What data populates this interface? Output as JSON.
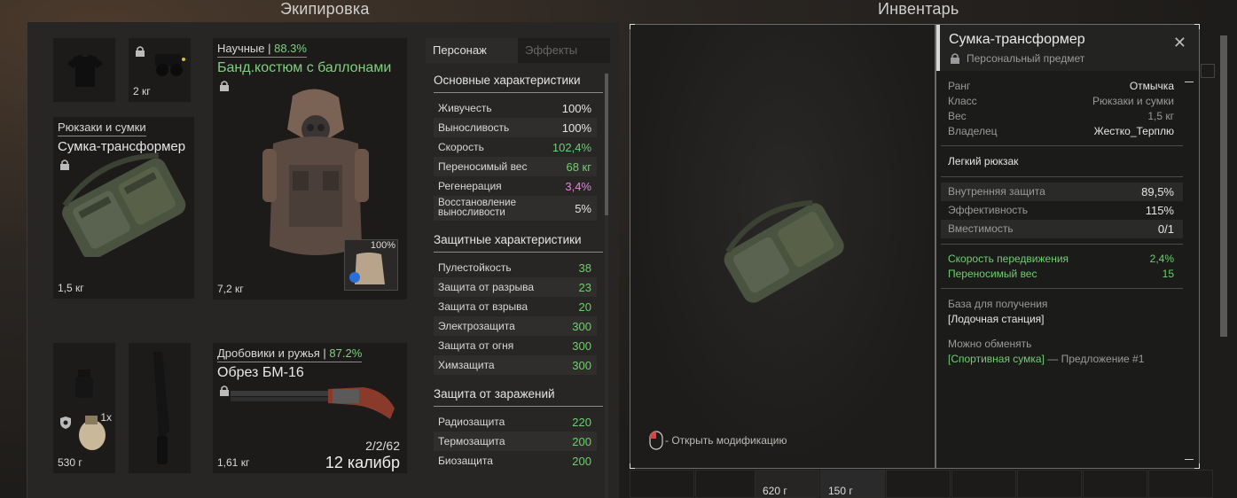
{
  "equipment": {
    "title": "Экипировка",
    "helmet_slot_weight": "",
    "nvg_slot_weight": "2 кг",
    "backpack": {
      "category": "Рюкзаки и сумки",
      "name": "Сумка-трансформер",
      "weight": "1,5 кг"
    },
    "armor": {
      "category": "Научные",
      "percent": "88.3%",
      "name": "Банд.костюм с баллонами",
      "weight": "7,2 кг",
      "plate_percent": "100%"
    },
    "secondary_slot": {
      "count": "1x",
      "weight": "530 г"
    },
    "weapon": {
      "category": "Дробовики и ружья",
      "percent": "87.2%",
      "name": "Обрез БМ-16",
      "weight": "1,61 кг",
      "ammo": "2/2/62",
      "caliber": "12 калибр"
    }
  },
  "stats": {
    "tabs": [
      "Персонаж",
      "Эффекты"
    ],
    "main_title": "Основные характеристики",
    "main_rows": [
      {
        "k": "Живучесть",
        "v": "100%",
        "c": ""
      },
      {
        "k": "Выносливость",
        "v": "100%",
        "c": ""
      },
      {
        "k": "Скорость",
        "v": "102,4%",
        "c": "green"
      },
      {
        "k": "Переносимый вес",
        "v": "68 кг",
        "c": "green"
      },
      {
        "k": "Регенерация",
        "v": "3,4%",
        "c": "pink"
      },
      {
        "k": "Восстановление выносливости",
        "v": "5%",
        "c": ""
      }
    ],
    "protect_title": "Защитные характеристики",
    "protect_rows": [
      {
        "k": "Пулестойкость",
        "v": "38"
      },
      {
        "k": "Защита от разрыва",
        "v": "23"
      },
      {
        "k": "Защита от взрыва",
        "v": "20"
      },
      {
        "k": "Электрозащита",
        "v": "300"
      },
      {
        "k": "Защита от огня",
        "v": "300"
      },
      {
        "k": "Химзащита",
        "v": "300"
      }
    ],
    "contam_title": "Защита от заражений",
    "contam_rows": [
      {
        "k": "Радиозащита",
        "v": "220"
      },
      {
        "k": "Термозащита",
        "v": "200"
      },
      {
        "k": "Биозащита",
        "v": "200"
      }
    ]
  },
  "inventory": {
    "title": "Инвентарь",
    "open_mods_hint": "- Открыть модификацию",
    "bottom_weights": [
      "620 г",
      "150 г"
    ]
  },
  "info": {
    "title": "Сумка-трансформер",
    "personal": "Персональный предмет",
    "rank_k": "Ранг",
    "rank_v": "Отмычка",
    "class_k": "Класс",
    "class_v": "Рюкзаки и сумки",
    "weight_k": "Вес",
    "weight_v": "1,5 кг",
    "owner_k": "Владелец",
    "owner_v": "Жестко_Терплю",
    "type": "Легкий рюкзак",
    "props": [
      {
        "k": "Внутренняя защита",
        "v": "89,5%"
      },
      {
        "k": "Эффективность",
        "v": "115%"
      },
      {
        "k": "Вместимость",
        "v": "0/1"
      }
    ],
    "bonuses": [
      {
        "k": "Скорость передвижения",
        "v": "2,4%"
      },
      {
        "k": "Переносимый вес",
        "v": "15"
      }
    ],
    "base_label": "База для получения",
    "base_value": "[Лодочная станция]",
    "trade_label": "Можно обменять",
    "trade_item": "[Спортивная сумка]",
    "trade_offer": " — Предложение #1"
  }
}
